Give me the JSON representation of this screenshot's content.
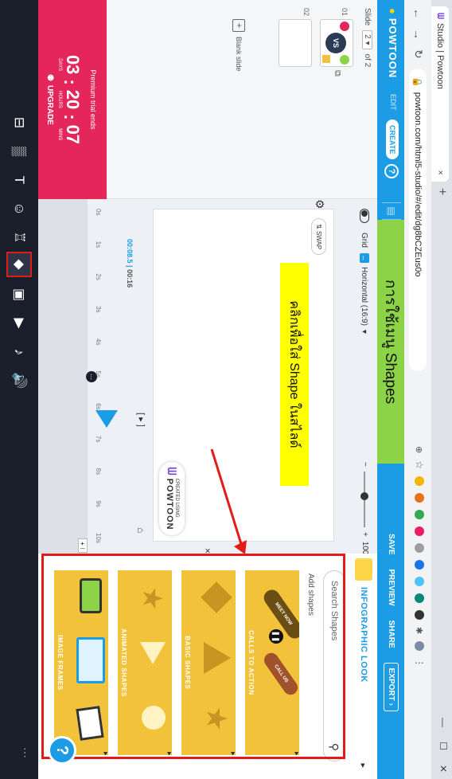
{
  "browser": {
    "tab_title": "Studio | Powtoon",
    "url": "powtoon.com/html5-studio/#/edit/dg8bCZEus0o"
  },
  "app": {
    "logo": "POWTOON",
    "mode_edit": "EDIT",
    "mode_create": "CREATE",
    "help": "?",
    "save": "SAVE",
    "preview": "PREVIEW",
    "share": "SHARE",
    "export": "EXPORT"
  },
  "tutorial": {
    "banner": "การใช้เมนู Shapes",
    "callout": "คลิกเพื่อใส่ Shape ในสไลด์"
  },
  "slides": {
    "label": "Slide",
    "current": "2",
    "of": "of 2",
    "items": [
      {
        "number": "01",
        "thumb": "VS"
      },
      {
        "number": "02",
        "thumb": ""
      }
    ],
    "blank_slide": "Blank slide"
  },
  "trial": {
    "text": "Premium trial ends",
    "days": "03",
    "hours": "20",
    "mins": "07",
    "days_label": "DAYS",
    "hours_label": "HOURS",
    "mins_label": "MINS",
    "upgrade": "UPGRADE"
  },
  "canvas": {
    "grid_label": "Grid",
    "ratio": "Horizontal (16:9)",
    "zoom": "100%",
    "swap": "SWAP",
    "badge_small": "CREATED USING",
    "badge_brand": "POWTOON"
  },
  "timeline": {
    "current": "00:08.5",
    "total": "00:16",
    "ticks": [
      "0s",
      "1s",
      "2s",
      "3s",
      "4s",
      "5s",
      "6s",
      "7s",
      "8s",
      "9s",
      "10s"
    ]
  },
  "shapes_panel": {
    "title": "INFOGRAPHIC LOOK",
    "search_placeholder": "Search Shapes",
    "add_shapes": "Add shapes",
    "categories": [
      {
        "label": "CALLS TO ACTION",
        "extra1": "MEET NOW",
        "extra2": "CALL US"
      },
      {
        "label": "BASIC SHAPES"
      },
      {
        "label": "ANIMATED SHAPES"
      },
      {
        "label": "IMAGE FRAMES"
      }
    ]
  },
  "colors": {
    "brand_blue": "#1d9ce6",
    "banner_green": "#8cd348",
    "callout_yellow": "#ffff00",
    "trial_pink": "#e5265a",
    "shape_yellow": "#f2c33a",
    "highlight_red": "#e21b1b",
    "dark_bar": "#1b1f2c"
  },
  "icons": [
    "home-icon",
    "bg-pattern-icon",
    "text-icon",
    "character-icon",
    "props-icon",
    "shapes-icon",
    "media-icon",
    "video-icon",
    "audio-icon",
    "sound-icon"
  ]
}
